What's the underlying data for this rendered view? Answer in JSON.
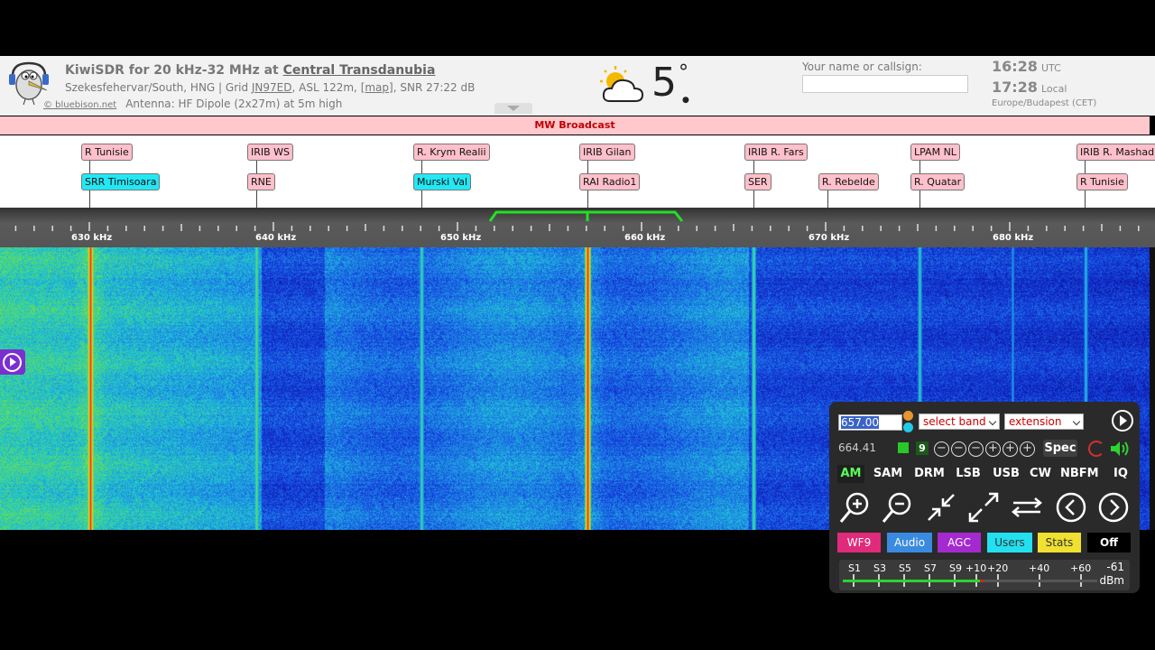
{
  "header": {
    "title_prefix": "KiwiSDR for 20 kHz-32 MHz at ",
    "title_location": "Central Transdanubia",
    "sub_loc": "Szekesfehervar/South, HNG | Grid ",
    "sub_grid": "JN97ED",
    "sub_asl": ", ASL 122m, ",
    "sub_map": "[map]",
    "sub_snr": ", SNR 27:22 dB",
    "copyright": "© bluebison.net",
    "antenna": "Antenna: HF Dipole (2x27m) at 5m high",
    "temperature": "5",
    "degree": "°",
    "name_label": "Your name or callsign:",
    "name_value": "",
    "utc_time": "16:28",
    "utc_label": "UTC",
    "local_time": "17:28",
    "local_label": "Local",
    "timezone": "Europe/Budapest (CET)"
  },
  "band_bar": "MW Broadcast",
  "station_labels": [
    {
      "name": "R Tunisie",
      "color": "pink"
    },
    {
      "name": "SRR Timisoara",
      "color": "cyan"
    },
    {
      "name": "IRIB WS",
      "color": "pink"
    },
    {
      "name": "RNE",
      "color": "pink"
    },
    {
      "name": "R. Krym Realii",
      "color": "pink"
    },
    {
      "name": "Murski Val",
      "color": "cyan"
    },
    {
      "name": "IRIB Gilan",
      "color": "pink"
    },
    {
      "name": "RAI Radio1",
      "color": "pink"
    },
    {
      "name": "IRIB R. Fars",
      "color": "pink"
    },
    {
      "name": "SER",
      "color": "pink"
    },
    {
      "name": "R. Rebelde",
      "color": "pink"
    },
    {
      "name": "LPAM NL",
      "color": "pink"
    },
    {
      "name": "R. Quatar",
      "color": "pink"
    },
    {
      "name": "IRIB R. Mashad",
      "color": "pink"
    },
    {
      "name": "R Tunisie",
      "color": "pink"
    }
  ],
  "scale_labels": [
    "630 kHz",
    "640 kHz",
    "650 kHz",
    "660 kHz",
    "670 kHz",
    "680 kHz"
  ],
  "panel": {
    "frequency": "657.00",
    "band_select": "select band",
    "extension_select": "extension",
    "passband_freq": "664.41",
    "step_value": "9",
    "spec_label": "Spec",
    "modes": [
      "AM",
      "SAM",
      "DRM",
      "LSB",
      "USB",
      "CW",
      "NBFM",
      "IQ"
    ],
    "active_mode": "AM",
    "controls": [
      {
        "label": "WF9",
        "color": "#e02a7a"
      },
      {
        "label": "Audio",
        "color": "#3a8ae0"
      },
      {
        "label": "AGC",
        "color": "#a42ad0"
      },
      {
        "label": "Users",
        "color": "#22e0f0"
      },
      {
        "label": "Stats",
        "color": "#f0e030"
      },
      {
        "label": "Off",
        "color": "#000000"
      }
    ],
    "smeter_labels": [
      "S1",
      "S3",
      "S5",
      "S7",
      "S9",
      "+10",
      "+20",
      "+40",
      "+60"
    ],
    "smeter_value": "-61",
    "smeter_unit": "dBm",
    "smeter_level": 0.55
  },
  "colors": {
    "accent_green": "#2dd42d",
    "waterfall_signal": "#ff2020"
  }
}
